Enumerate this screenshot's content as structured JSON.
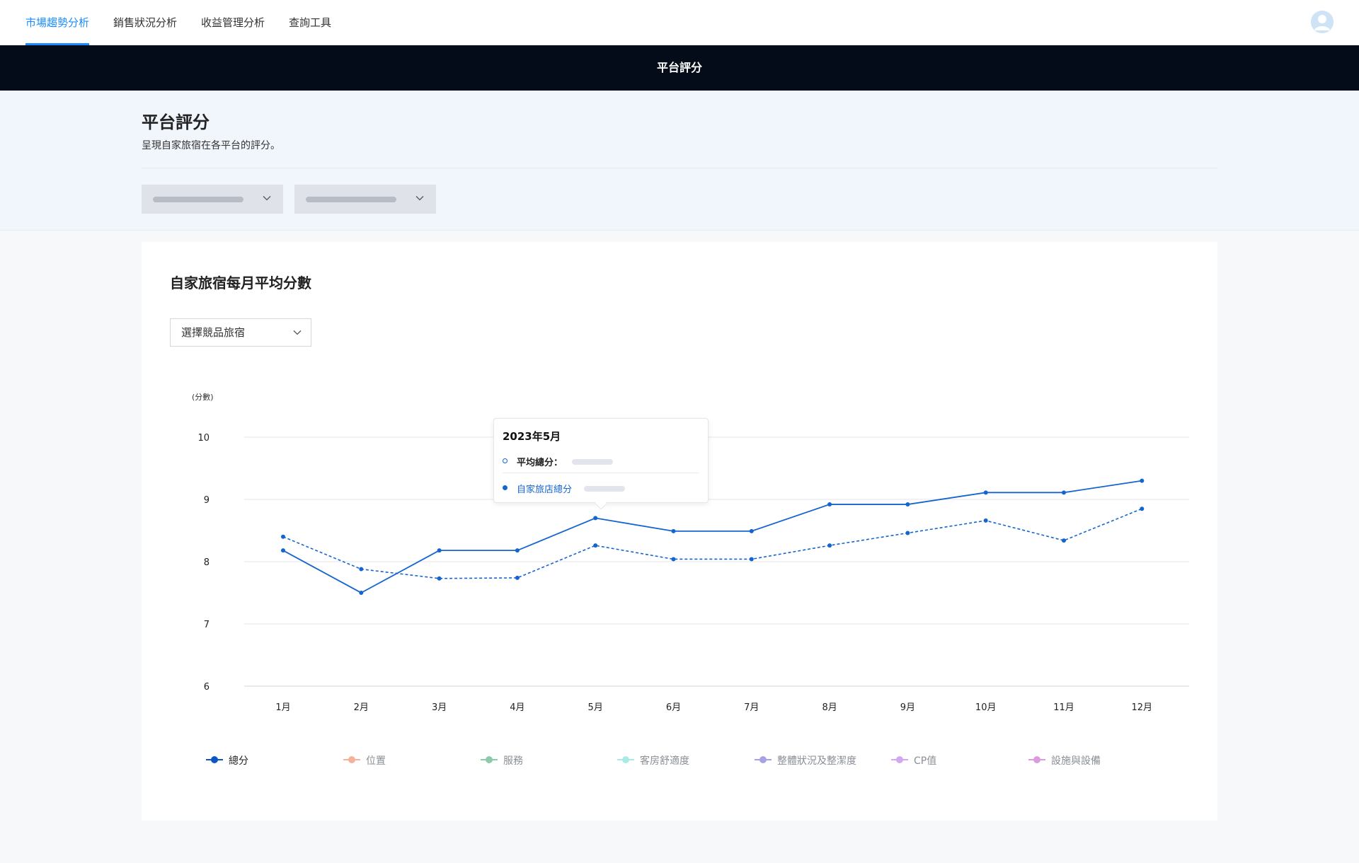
{
  "nav": {
    "tabs": [
      "市場趨勢分析",
      "銷售狀況分析",
      "收益管理分析",
      "查詢工具"
    ],
    "active_index": 0
  },
  "title_bar": "平台評分",
  "header": {
    "title": "平台評分",
    "description": "呈現自家旅宿在各平台的評分。"
  },
  "card": {
    "title": "自家旅宿每月平均分數",
    "competitor_select": "選擇競品旅宿"
  },
  "tooltip": {
    "title": "2023年5月",
    "avg_label": "平均總分：",
    "own_label": "自家旅店總分"
  },
  "colors": {
    "accent": "#1a8cff",
    "line": "#1565d0",
    "title_bar_bg": "#030c18",
    "header_bg": "#f1f6fd"
  },
  "chart_data": {
    "type": "line",
    "y_unit_label": "(分數)",
    "categories": [
      "1月",
      "2月",
      "3月",
      "4月",
      "5月",
      "6月",
      "7月",
      "8月",
      "9月",
      "10月",
      "11月",
      "12月"
    ],
    "ylim": [
      6,
      10
    ],
    "yticks": [
      6,
      7,
      8,
      9,
      10
    ],
    "grid": true,
    "series": [
      {
        "name": "總分",
        "style": "solid",
        "values": [
          8.18,
          7.5,
          8.18,
          8.18,
          8.7,
          8.49,
          8.49,
          8.92,
          8.92,
          9.11,
          9.11,
          9.3
        ]
      },
      {
        "style": "dashed",
        "values": [
          8.4,
          7.88,
          7.73,
          7.74,
          8.26,
          8.04,
          8.04,
          8.26,
          8.46,
          8.66,
          8.34,
          8.85
        ]
      }
    ],
    "legend": [
      {
        "label": "總分",
        "color": "#0b56c6",
        "active": true
      },
      {
        "label": "位置",
        "color": "#f5b29a",
        "active": false
      },
      {
        "label": "服務",
        "color": "#8ccaa9",
        "active": false
      },
      {
        "label": "客房舒適度",
        "color": "#a9eae4",
        "active": false
      },
      {
        "label": "整體狀況及整潔度",
        "color": "#a4a3e4",
        "active": false
      },
      {
        "label": "CP值",
        "color": "#d3a8f2",
        "active": false
      },
      {
        "label": "設施與設備",
        "color": "#dc9adf",
        "active": false
      }
    ],
    "legend_position": "bottom",
    "highlighted_category": "5月"
  }
}
